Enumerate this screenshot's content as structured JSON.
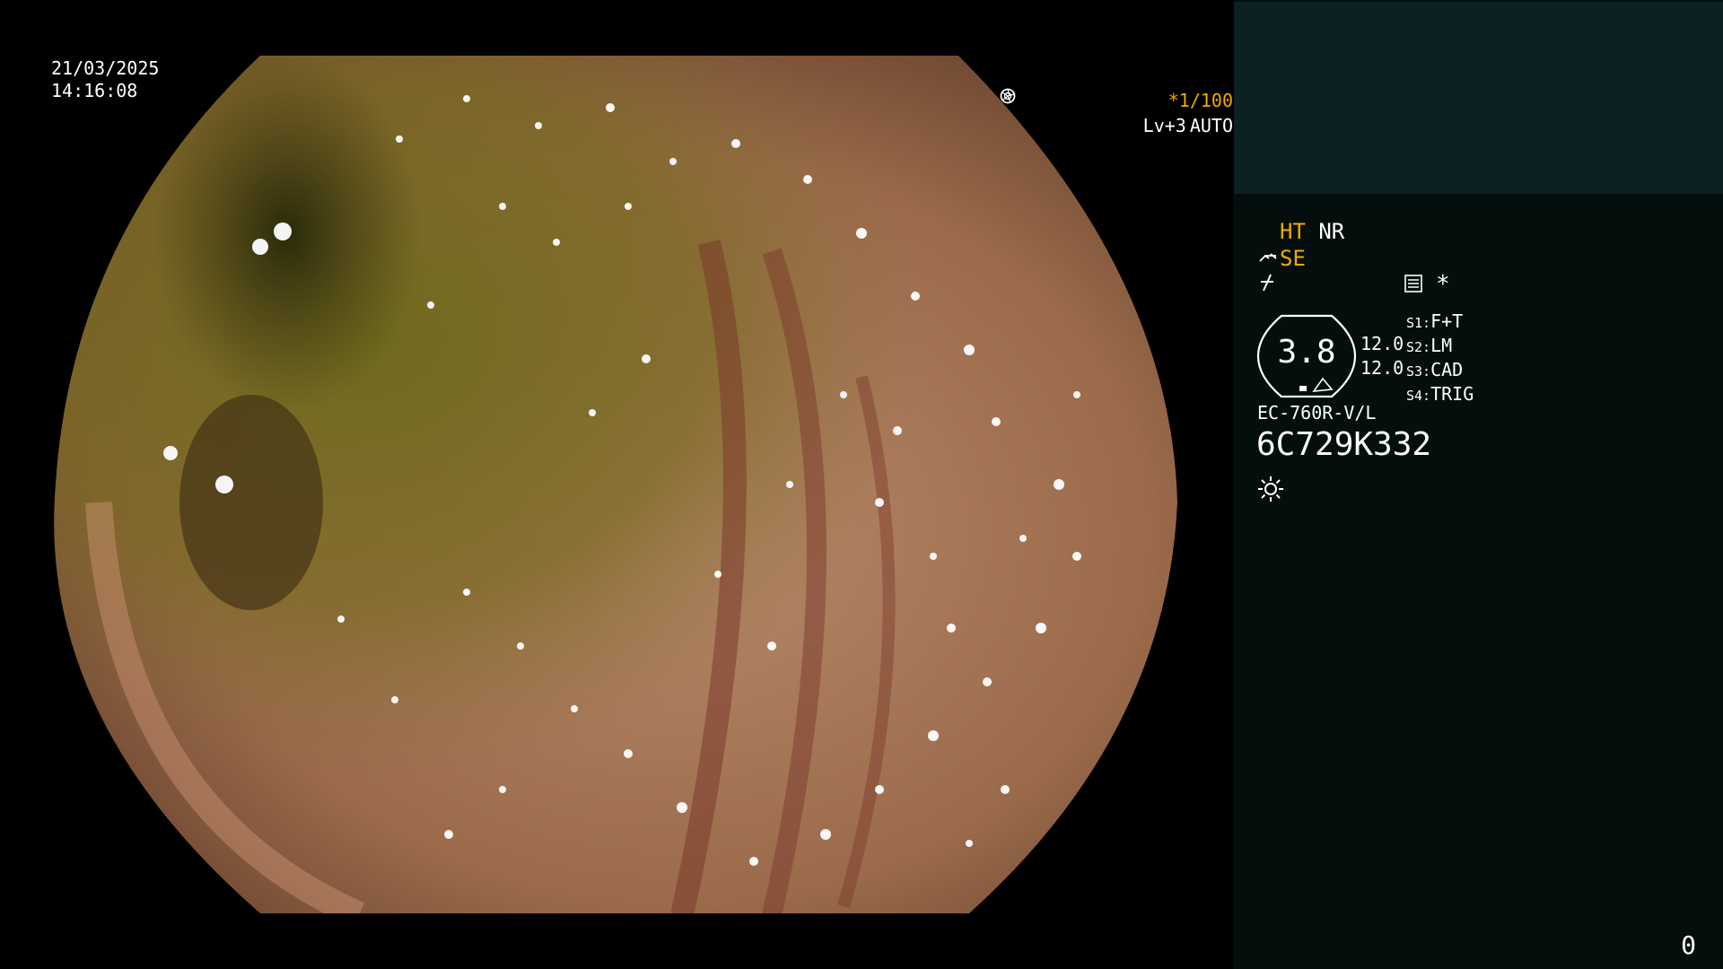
{
  "overlay": {
    "date": "21/03/2025",
    "time": "14:16:08",
    "shutter": "*1/100",
    "level": "Lv+3",
    "exposure_mode": "AUTO"
  },
  "panel": {
    "mode_ht": "HT",
    "mode_nr": "NR",
    "mode_se": "SE",
    "asterisk": "*",
    "gauge_value": "3.8",
    "gauge_side_top": "12.0",
    "gauge_side_bottom": "12.0",
    "settings": [
      {
        "key": "S1:",
        "value": "F+T"
      },
      {
        "key": "S2:",
        "value": "LM"
      },
      {
        "key": "S3:",
        "value": "CAD"
      },
      {
        "key": "S4:",
        "value": "TRIG"
      }
    ],
    "model": "EC-760R-V/L",
    "serial": "6C729K332",
    "counter": "0"
  },
  "colors": {
    "accent_orange": "#f2a900",
    "panel_top": "#0c2122",
    "panel_bg": "#040f0d"
  },
  "icons": [
    "aperture-icon",
    "iris-icon",
    "scope-tip-icon",
    "freeze-icon",
    "menu-icon",
    "sun-icon"
  ]
}
